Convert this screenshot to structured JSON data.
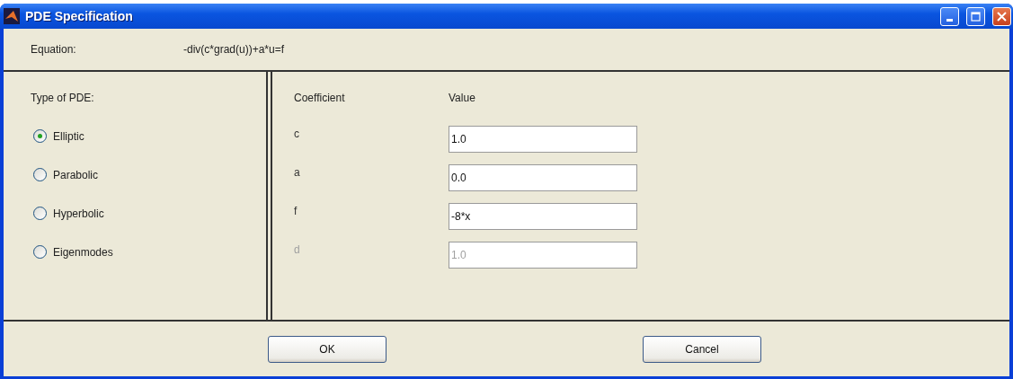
{
  "window": {
    "title": "PDE Specification"
  },
  "equation": {
    "label": "Equation:",
    "value": "-div(c*grad(u))+a*u=f"
  },
  "pde_type": {
    "label": "Type of PDE:",
    "options": [
      {
        "label": "Elliptic",
        "selected": true
      },
      {
        "label": "Parabolic",
        "selected": false
      },
      {
        "label": "Hyperbolic",
        "selected": false
      },
      {
        "label": "Eigenmodes",
        "selected": false
      }
    ]
  },
  "coefficients": {
    "columns": [
      "Coefficient",
      "Value"
    ],
    "rows": [
      {
        "name": "c",
        "value": "1.0",
        "disabled": false
      },
      {
        "name": "a",
        "value": "0.0",
        "disabled": false
      },
      {
        "name": "f",
        "value": "-8*x",
        "disabled": false
      },
      {
        "name": "d",
        "value": "1.0",
        "disabled": true
      }
    ]
  },
  "buttons": [
    "OK",
    "Cancel"
  ]
}
